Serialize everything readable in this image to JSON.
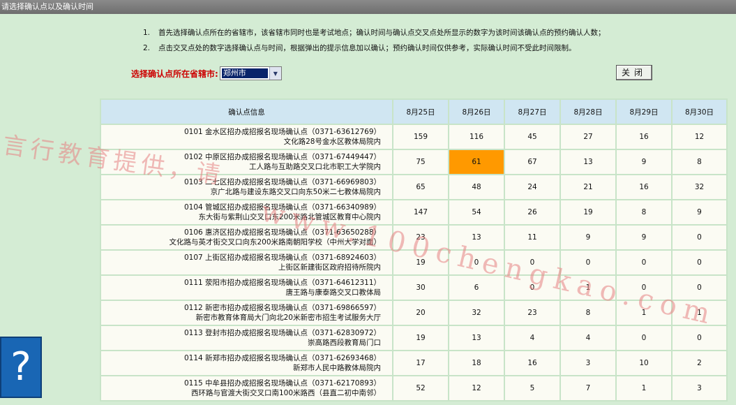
{
  "window": {
    "title": "请选择确认点以及确认时间"
  },
  "instructions": [
    {
      "num": "1.",
      "text": "首先选择确认点所在的省辖市，该省辖市同时也是考试地点；确认时间与确认点交叉点处所显示的数字为该时间该确认点的预约确认人数；"
    },
    {
      "num": "2.",
      "text": "点击交叉点处的数字选择确认点与时间，根据弹出的提示信息加以确认；预约确认时间仅供参考，实际确认时间不受此时间限制。"
    }
  ],
  "city_select": {
    "label": "选择确认点所在省辖市:",
    "selected": "郑州市"
  },
  "close_button": {
    "label": "关闭"
  },
  "table": {
    "header_info": "确认点信息",
    "dates": [
      "8月25日",
      "8月26日",
      "8月27日",
      "8月28日",
      "8月29日",
      "8月30日"
    ],
    "rows": [
      {
        "name": "0101 金水区招办成招报名现场确认点（0371-63612769）",
        "address": "文化路28号金水区教体局院内",
        "counts": [
          "159",
          "116",
          "45",
          "27",
          "16",
          "12"
        ]
      },
      {
        "name": "0102 中原区招办成招报名现场确认点（0371-67449447）",
        "address": "工人路与互助路交叉口北市职工大学院内",
        "counts": [
          "75",
          "61",
          "67",
          "13",
          "9",
          "8"
        ]
      },
      {
        "name": "0103 二七区招办成招报名现场确认点（0371-66969803）",
        "address": "京广北路与建设东路交叉口向东50米二七教体局院内",
        "counts": [
          "65",
          "48",
          "24",
          "21",
          "16",
          "32"
        ]
      },
      {
        "name": "0104 管城区招办成招报名现场确认点（0371-66340989）",
        "address": "东大街与紫荆山交叉口东200米路北管城区教育中心院内",
        "counts": [
          "147",
          "54",
          "26",
          "19",
          "8",
          "9"
        ]
      },
      {
        "name": "0106 惠济区招办成招报名现场确认点（0371-63650288）",
        "address": "文化路与英才街交叉口向东200米路南朝阳学校（中州大学对面）",
        "counts": [
          "23",
          "13",
          "11",
          "9",
          "9",
          "0"
        ]
      },
      {
        "name": "0107 上街区招办成招报名现场确认点（0371-68924603）",
        "address": "上街区新建街区政府招待所院内",
        "counts": [
          "19",
          "0",
          "0",
          "0",
          "0",
          "0"
        ]
      },
      {
        "name": "0111 荥阳市招办成招报名现场确认点（0371-64612311）",
        "address": "唐王路与康泰路交叉口教体局",
        "counts": [
          "30",
          "6",
          "0",
          "1",
          "0",
          "0"
        ]
      },
      {
        "name": "0112 新密市招办成招报名现场确认点（0371-69866597）",
        "address": "新密市教育体育局大门向北20米新密市招生考试服务大厅",
        "counts": [
          "20",
          "32",
          "23",
          "8",
          "1",
          "1"
        ]
      },
      {
        "name": "0113 登封市招办成招报名现场确认点（0371-62830972）",
        "address": "崇高路西段教育局门口",
        "counts": [
          "19",
          "13",
          "4",
          "4",
          "0",
          "0"
        ]
      },
      {
        "name": "0114 新郑市招办成招报名现场确认点（0371-62693468）",
        "address": "新郑市人民中路教体局院内",
        "counts": [
          "17",
          "18",
          "16",
          "3",
          "10",
          "2"
        ]
      },
      {
        "name": "0115 中牟县招办成招报名现场确认点（0371-62170893）",
        "address": "西环路与官渡大街交叉口南100米路西（县直二初中南邻）",
        "counts": [
          "52",
          "12",
          "5",
          "7",
          "1",
          "3"
        ]
      }
    ],
    "highlighted_cell": {
      "row": 1,
      "col": 1,
      "color": "#ff9900"
    }
  },
  "help_button": {
    "glyph": "?",
    "icon": "help-icon",
    "color": "#1966b4"
  },
  "watermarks": [
    "言行教育提供，请",
    "www.100chengkao.com"
  ]
}
